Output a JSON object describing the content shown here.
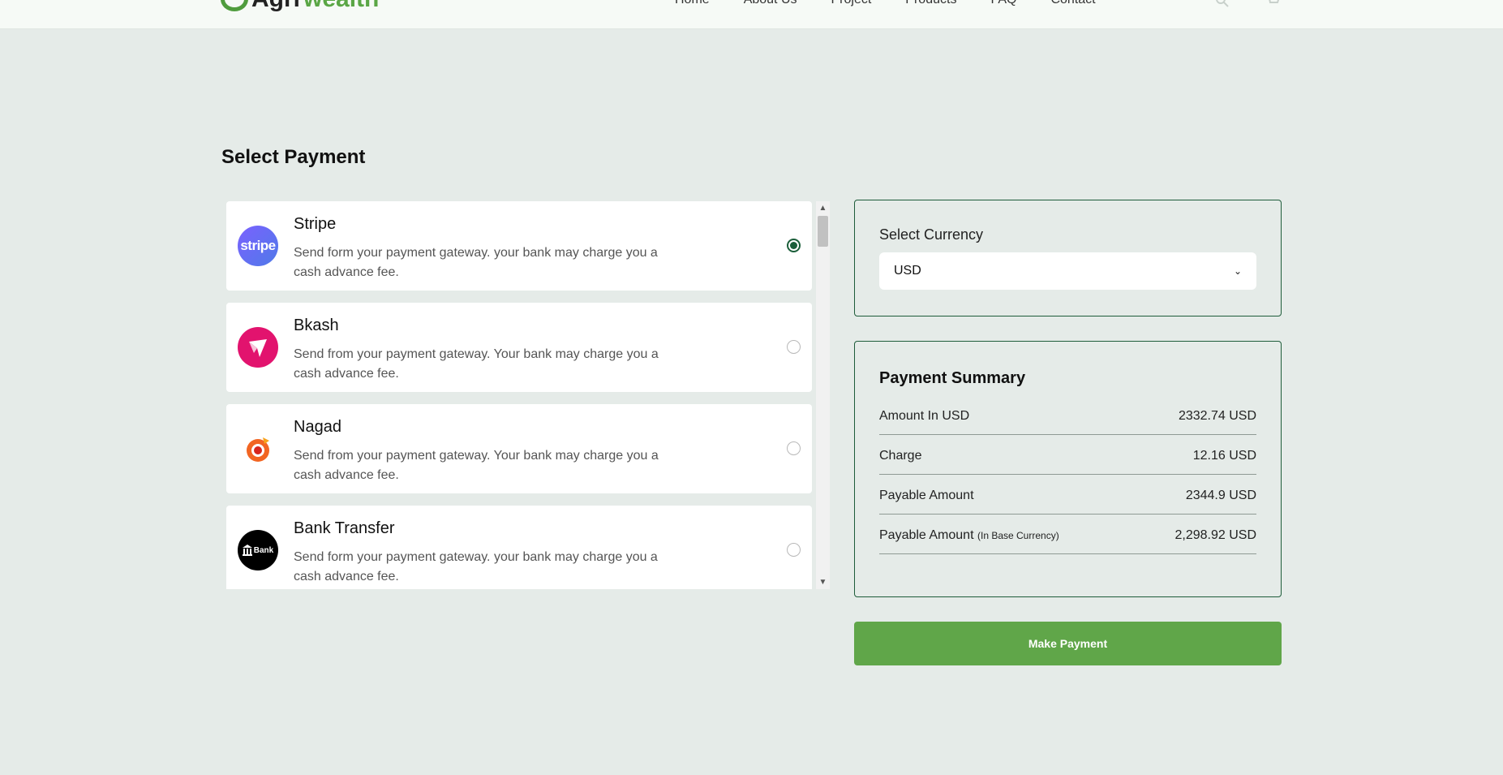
{
  "header": {
    "logo_part1": "Agri",
    "logo_part2": "wealth",
    "nav": [
      "Home",
      "About Us",
      "Project",
      "Products",
      "FAQ",
      "Contact"
    ],
    "icons": [
      "search-icon",
      "cart-icon"
    ]
  },
  "page": {
    "title": "Select Payment"
  },
  "gateways": [
    {
      "name": "Stripe",
      "logo_text": "stripe",
      "logo_color": "#6772e5",
      "desc": "Send form your payment gateway. your bank may charge you a cash advance fee.",
      "selected": true
    },
    {
      "name": "Bkash",
      "logo_text": "",
      "logo_color": "#e2136e",
      "desc": "Send from your payment gateway. Your bank may charge you a cash advance fee.",
      "selected": false
    },
    {
      "name": "Nagad",
      "logo_text": "",
      "logo_color": "#f5501e",
      "desc": "Send from your payment gateway. Your bank may charge you a cash advance fee.",
      "selected": false
    },
    {
      "name": "Bank Transfer",
      "logo_text": "Bank",
      "logo_color": "#000000",
      "desc": "Send form your payment gateway. your bank may charge you a cash advance fee.",
      "selected": false
    }
  ],
  "currency": {
    "label": "Select Currency",
    "selected": "USD"
  },
  "summary": {
    "title": "Payment Summary",
    "rows": [
      {
        "label": "Amount In USD",
        "value": "2332.74 USD"
      },
      {
        "label": "Charge",
        "value": "12.16 USD"
      },
      {
        "label": "Payable Amount",
        "value": "2344.9 USD"
      },
      {
        "label": "Payable Amount",
        "sub": "(In Base Currency)",
        "value": "2,298.92 USD"
      }
    ]
  },
  "actions": {
    "pay_label": "Make Payment"
  },
  "colors": {
    "accent": "#60a649",
    "border": "#1e5c3a",
    "background": "#e5ebe8"
  }
}
